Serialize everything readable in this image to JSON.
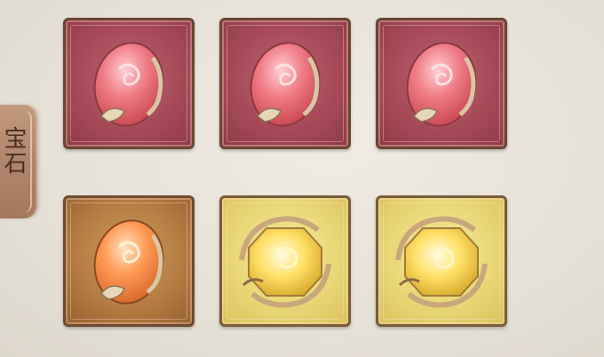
{
  "side_tab": {
    "label": "宝石"
  },
  "slots": [
    {
      "id": "gem-1",
      "rarity": "red",
      "gem": "red-oval-gem-icon"
    },
    {
      "id": "gem-2",
      "rarity": "red",
      "gem": "red-oval-gem-icon"
    },
    {
      "id": "gem-3",
      "rarity": "red",
      "gem": "red-oval-gem-icon"
    },
    {
      "id": "gem-4",
      "rarity": "orange",
      "gem": "orange-oval-gem-icon"
    },
    {
      "id": "gem-5",
      "rarity": "gold",
      "gem": "yellow-octagon-gem-icon"
    },
    {
      "id": "gem-6",
      "rarity": "gold",
      "gem": "yellow-octagon-gem-icon"
    }
  ],
  "colors": {
    "red_frame": "#a64a58",
    "orange_frame": "#b57d44",
    "gold_frame": "#e9d777",
    "tab": "#b18569"
  }
}
